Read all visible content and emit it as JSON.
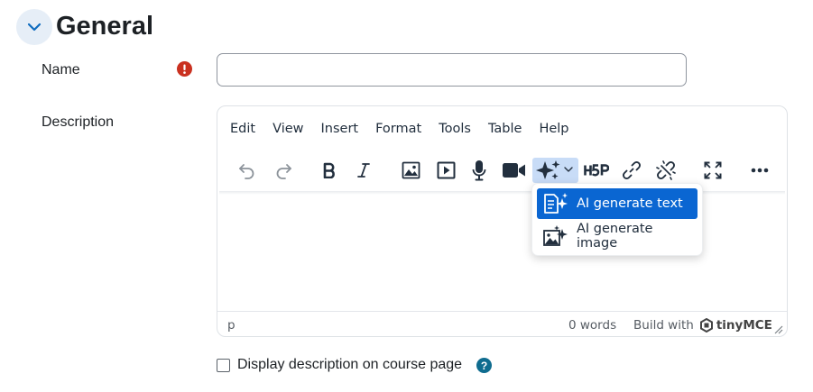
{
  "section": {
    "title": "General",
    "toggle_icon": "chevron-down-icon"
  },
  "fields": {
    "name": {
      "label": "Name",
      "value": "",
      "placeholder": "",
      "required_icon": "required-exclamation-icon",
      "required_color": "#ca3120"
    },
    "description": {
      "label": "Description"
    }
  },
  "editor": {
    "menubar": [
      "Edit",
      "View",
      "Insert",
      "Format",
      "Tools",
      "Table",
      "Help"
    ],
    "toolbar_icons": [
      "undo-icon",
      "redo-icon",
      "bold-icon",
      "italic-icon",
      "image-icon",
      "media-icon",
      "microphone-icon",
      "video-camera-icon",
      "ai-sparkle-icon",
      "h5p-icon",
      "link-icon",
      "unlink-icon",
      "fullscreen-icon",
      "more-icon"
    ],
    "ai_dropdown": {
      "items": [
        {
          "label": "AI generate text",
          "icon": "ai-generate-text-icon",
          "active": true
        },
        {
          "label": "AI generate image",
          "icon": "ai-generate-image-icon",
          "active": false
        }
      ]
    },
    "statusbar": {
      "path": "p",
      "word_count": "0 words",
      "build_with": "Build with",
      "brand": "tinyMCE"
    },
    "colors": {
      "accent": "#0a66d2",
      "button_highlight": "#c8dcf7",
      "icon": "#222f3e"
    }
  },
  "display_description": {
    "label": "Display description on course page",
    "checked": false,
    "help_icon": "help-question-icon",
    "help_glyph": "?"
  }
}
